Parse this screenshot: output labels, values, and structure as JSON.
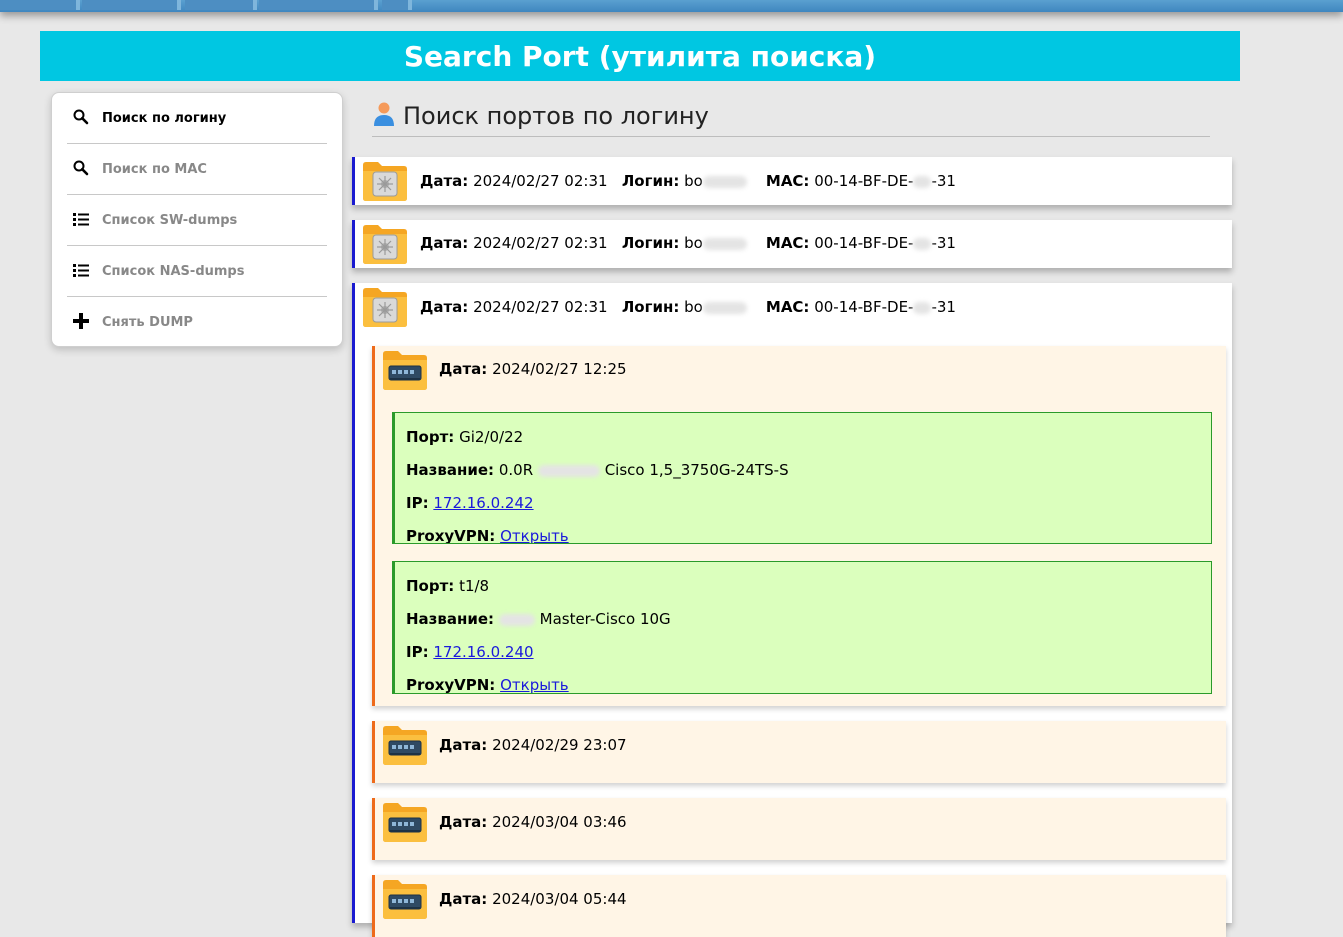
{
  "page": {
    "title": "Search Port (утилита поиска)"
  },
  "sidebar": {
    "items": [
      {
        "label": "Поиск по логину",
        "icon": "search-icon",
        "active": true
      },
      {
        "label": "Поиск по MAC",
        "icon": "search-icon",
        "active": false
      },
      {
        "label": "Список SW-dumps",
        "icon": "list-icon",
        "active": false
      },
      {
        "label": "Список NAS-dumps",
        "icon": "list-icon",
        "active": false
      },
      {
        "label": "Снять DUMP",
        "icon": "plus-icon",
        "active": false
      }
    ]
  },
  "main": {
    "heading": "Поиск портов по логину",
    "heading_icon": "user-icon",
    "labels": {
      "date": "Дата:",
      "login": "Логин:",
      "mac": "MAC:",
      "port": "Порт:",
      "name": "Название:",
      "ip": "IP:",
      "proxy": "ProxyVPN:"
    },
    "results": [
      {
        "date": "2024/02/27 02:31",
        "login": "bo",
        "mac_start": "00-14-BF-DE-",
        "mac_end": "-31"
      },
      {
        "date": "2024/02/27 02:31",
        "login": "bo",
        "mac_start": "00-14-BF-DE-",
        "mac_end": "-31"
      },
      {
        "date": "2024/02/27 02:31",
        "login": "bo",
        "mac_start": "00-14-BF-DE-",
        "mac_end": "-31",
        "dumps": [
          {
            "date": "2024/02/27 12:25",
            "ports": [
              {
                "port": "Gi2/0/22",
                "name_start": "0.0R",
                "name_end": "Cisco 1,5_3750G-24TS-S",
                "ip": "172.16.0.242",
                "proxy_link": "Открыть"
              },
              {
                "port": "t1/8",
                "name_start": "",
                "name_end": "Master-Cisco 10G",
                "ip": "172.16.0.240",
                "proxy_link": "Открыть"
              }
            ]
          },
          {
            "date": "2024/02/29 23:07"
          },
          {
            "date": "2024/03/04 03:46"
          },
          {
            "date": "2024/03/04 05:44"
          }
        ]
      }
    ]
  },
  "colors": {
    "banner": "#00c7e2",
    "card_accent": "#1a1ad0",
    "dump_accent": "#ee6a1a",
    "port_bg": "#dbffbd",
    "port_border": "#2a9a2a",
    "link": "#1a1adb",
    "folder": "#f5a623"
  }
}
